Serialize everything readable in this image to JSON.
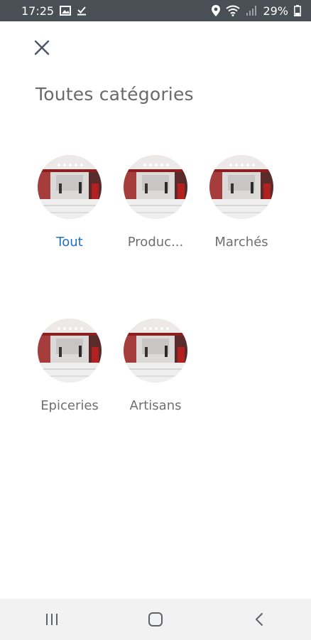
{
  "status_bar": {
    "time": "17:25",
    "battery": "29%",
    "icons": [
      "image-icon",
      "download-done-icon",
      "location-icon",
      "wifi-icon",
      "signal-icon",
      "battery-icon"
    ]
  },
  "header": {
    "close_icon": "close-icon",
    "title": "Toutes catégories"
  },
  "categories": [
    {
      "label": "Tout",
      "active": true
    },
    {
      "label": "Produc...",
      "active": false
    },
    {
      "label": "Marchés",
      "active": false
    },
    {
      "label": "Epiceries",
      "active": false
    },
    {
      "label": "Artisans",
      "active": false
    }
  ],
  "nav_bar": {
    "icons": [
      "recent-apps-icon",
      "home-icon",
      "back-icon"
    ]
  },
  "colors": {
    "active": "#1f6fc4",
    "text": "#6f6f6f",
    "status_bar": "#4a4f55"
  }
}
